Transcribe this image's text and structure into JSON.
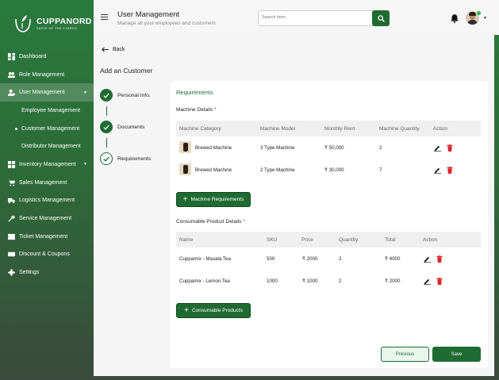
{
  "brand": {
    "name": "CUPPANORD",
    "tagline": "TASTE OF THE FJORDS"
  },
  "sidebar": {
    "items": [
      {
        "label": "Dashboard",
        "icon": "dashboard-icon"
      },
      {
        "label": "Role Management",
        "icon": "users-icon"
      },
      {
        "label": "User Management",
        "icon": "user-gear-icon"
      },
      {
        "label": "Employee Management"
      },
      {
        "label": "Customer Management"
      },
      {
        "label": "Distributor Management"
      },
      {
        "label": "Inventory Management",
        "icon": "inventory-icon"
      },
      {
        "label": "Sales Management",
        "icon": "cart-icon"
      },
      {
        "label": "Logistics Management",
        "icon": "truck-icon"
      },
      {
        "label": "Service Management",
        "icon": "wrench-icon"
      },
      {
        "label": "Ticket Management",
        "icon": "ticket-icon"
      },
      {
        "label": "Discount & Coupons",
        "icon": "coupon-icon"
      },
      {
        "label": "Settings",
        "icon": "gear-icon"
      }
    ]
  },
  "header": {
    "title": "User Management",
    "subtitle": "Manage all your employees and customers",
    "search_placeholder": "Search here"
  },
  "main": {
    "back_label": "Back",
    "page_title": "Add an Customer",
    "steps": [
      {
        "label": "Personal Info.",
        "state": "done"
      },
      {
        "label": "Documents",
        "state": "done"
      },
      {
        "label": "Requirements",
        "state": "current"
      }
    ],
    "section_title": "Requirements",
    "machine": {
      "title": "Machine Details",
      "required_mark": "*",
      "columns": [
        "Machine Category",
        "Machine Model",
        "Monthly Rent",
        "Machine Quantity",
        "Action"
      ],
      "rows": [
        {
          "category": "Brewed Machine",
          "model": "3 Type Machine",
          "rent": "₹ 50,000",
          "qty": "2"
        },
        {
          "category": "Brewed Machine",
          "model": "2 Type Machine",
          "rent": "₹ 30,000",
          "qty": "7"
        }
      ],
      "add_button": "Machine Requirements"
    },
    "consumable": {
      "title": "Consumable Product Details",
      "required_mark": "*",
      "columns": [
        "Name",
        "SKU",
        "Price",
        "Quantity",
        "Total",
        "Action"
      ],
      "rows": [
        {
          "name": "Cuppamix - Masala Tea",
          "sku": "500",
          "price": "₹ 2000",
          "qty": "2",
          "total": "₹ 4000"
        },
        {
          "name": "Cuppamix - Lemon Tea",
          "sku": "1000",
          "price": "₹ 1000",
          "qty": "2",
          "total": "₹ 2000"
        }
      ],
      "add_button": "Consumable Products"
    },
    "previous_button": "Previous",
    "save_button": "Save"
  },
  "colors": {
    "primary": "#1f6b33",
    "danger": "#e02424"
  }
}
